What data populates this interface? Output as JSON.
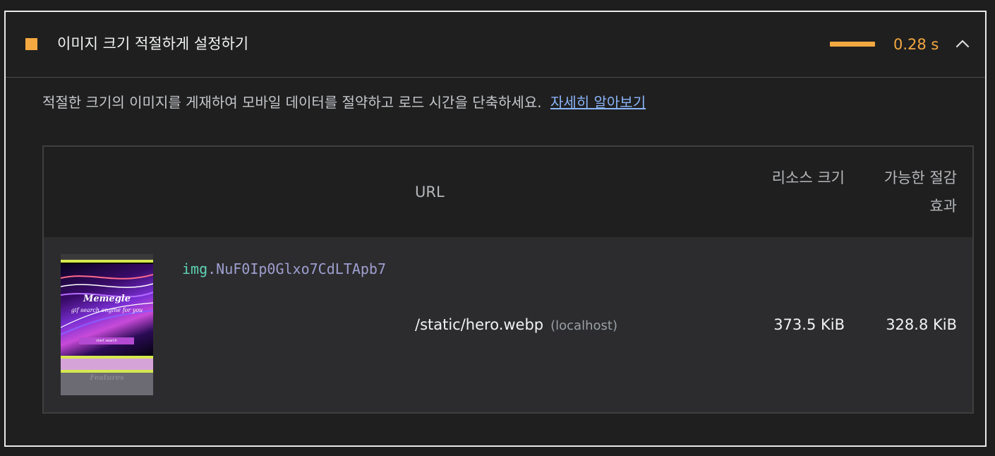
{
  "audit": {
    "title": "이미지 크기 적절하게 설정하기",
    "metric_value": "0.28 s",
    "status_color": "#f4a841",
    "status_icon": "orange-square-icon",
    "toggle_icon": "chevron-up-icon",
    "description": "적절한 크기의 이미지를 게재하여 모바일 데이터를 절약하고 로드 시간을 단축하세요.",
    "learn_more": "자세히 알아보기"
  },
  "table": {
    "headers": {
      "url": "URL",
      "resource_size": "리소스 크기",
      "potential_savings": "가능한 절감 효과"
    },
    "rows": [
      {
        "thumbnail": {
          "brand": "Memegle",
          "tagline": "gif search engine for you",
          "cta": "start search",
          "section": "Features"
        },
        "node_tag": "img",
        "node_selector": ".NuF0Ip0Glxo7CdLTApb7",
        "url": "/static/hero.webp",
        "origin": "(localhost)",
        "resource_size": "373.5 KiB",
        "potential_savings": "328.8 KiB"
      }
    ]
  }
}
